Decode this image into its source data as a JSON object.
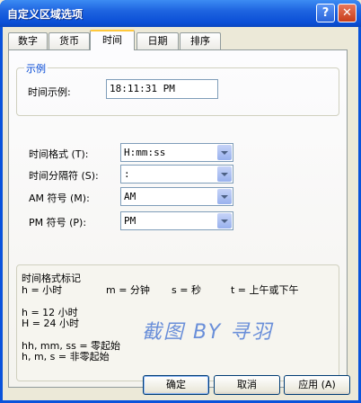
{
  "window": {
    "title": "自定义区域选项"
  },
  "titlebar_buttons": {
    "help": "?",
    "close": "✕"
  },
  "tabs": [
    "数字",
    "货币",
    "时间",
    "日期",
    "排序"
  ],
  "active_tab": "时间",
  "sample_group": {
    "label": "示例",
    "field_label": "时间示例:",
    "value": "18:11:31 PM"
  },
  "settings": [
    {
      "label": "时间格式 (T):",
      "value": "H:mm:ss"
    },
    {
      "label": "时间分隔符 (S):",
      "value": ":"
    },
    {
      "label": "AM 符号 (M):",
      "value": "AM"
    },
    {
      "label": "PM 符号 (P):",
      "value": "PM"
    }
  ],
  "notes": {
    "title": "时间格式标记",
    "line1": [
      "h = 小时",
      "m = 分钟",
      "s = 秒",
      "t = 上午或下午"
    ],
    "line2": "h = 12 小时",
    "line3": "H = 24 小时",
    "line4": "hh, mm, ss = 零起始",
    "line5": "h, m, s = 非零起始"
  },
  "watermark": "截图 BY 寻羽",
  "buttons": {
    "ok": "确定",
    "cancel": "取消",
    "apply": "应用 (A)"
  },
  "colors": {
    "title_blue": "#0A53DB",
    "face": "#ECE9D8",
    "group_label": "#0046D5",
    "watermark": "#6A8FD9",
    "tab_highlight": "#FFC83C"
  }
}
